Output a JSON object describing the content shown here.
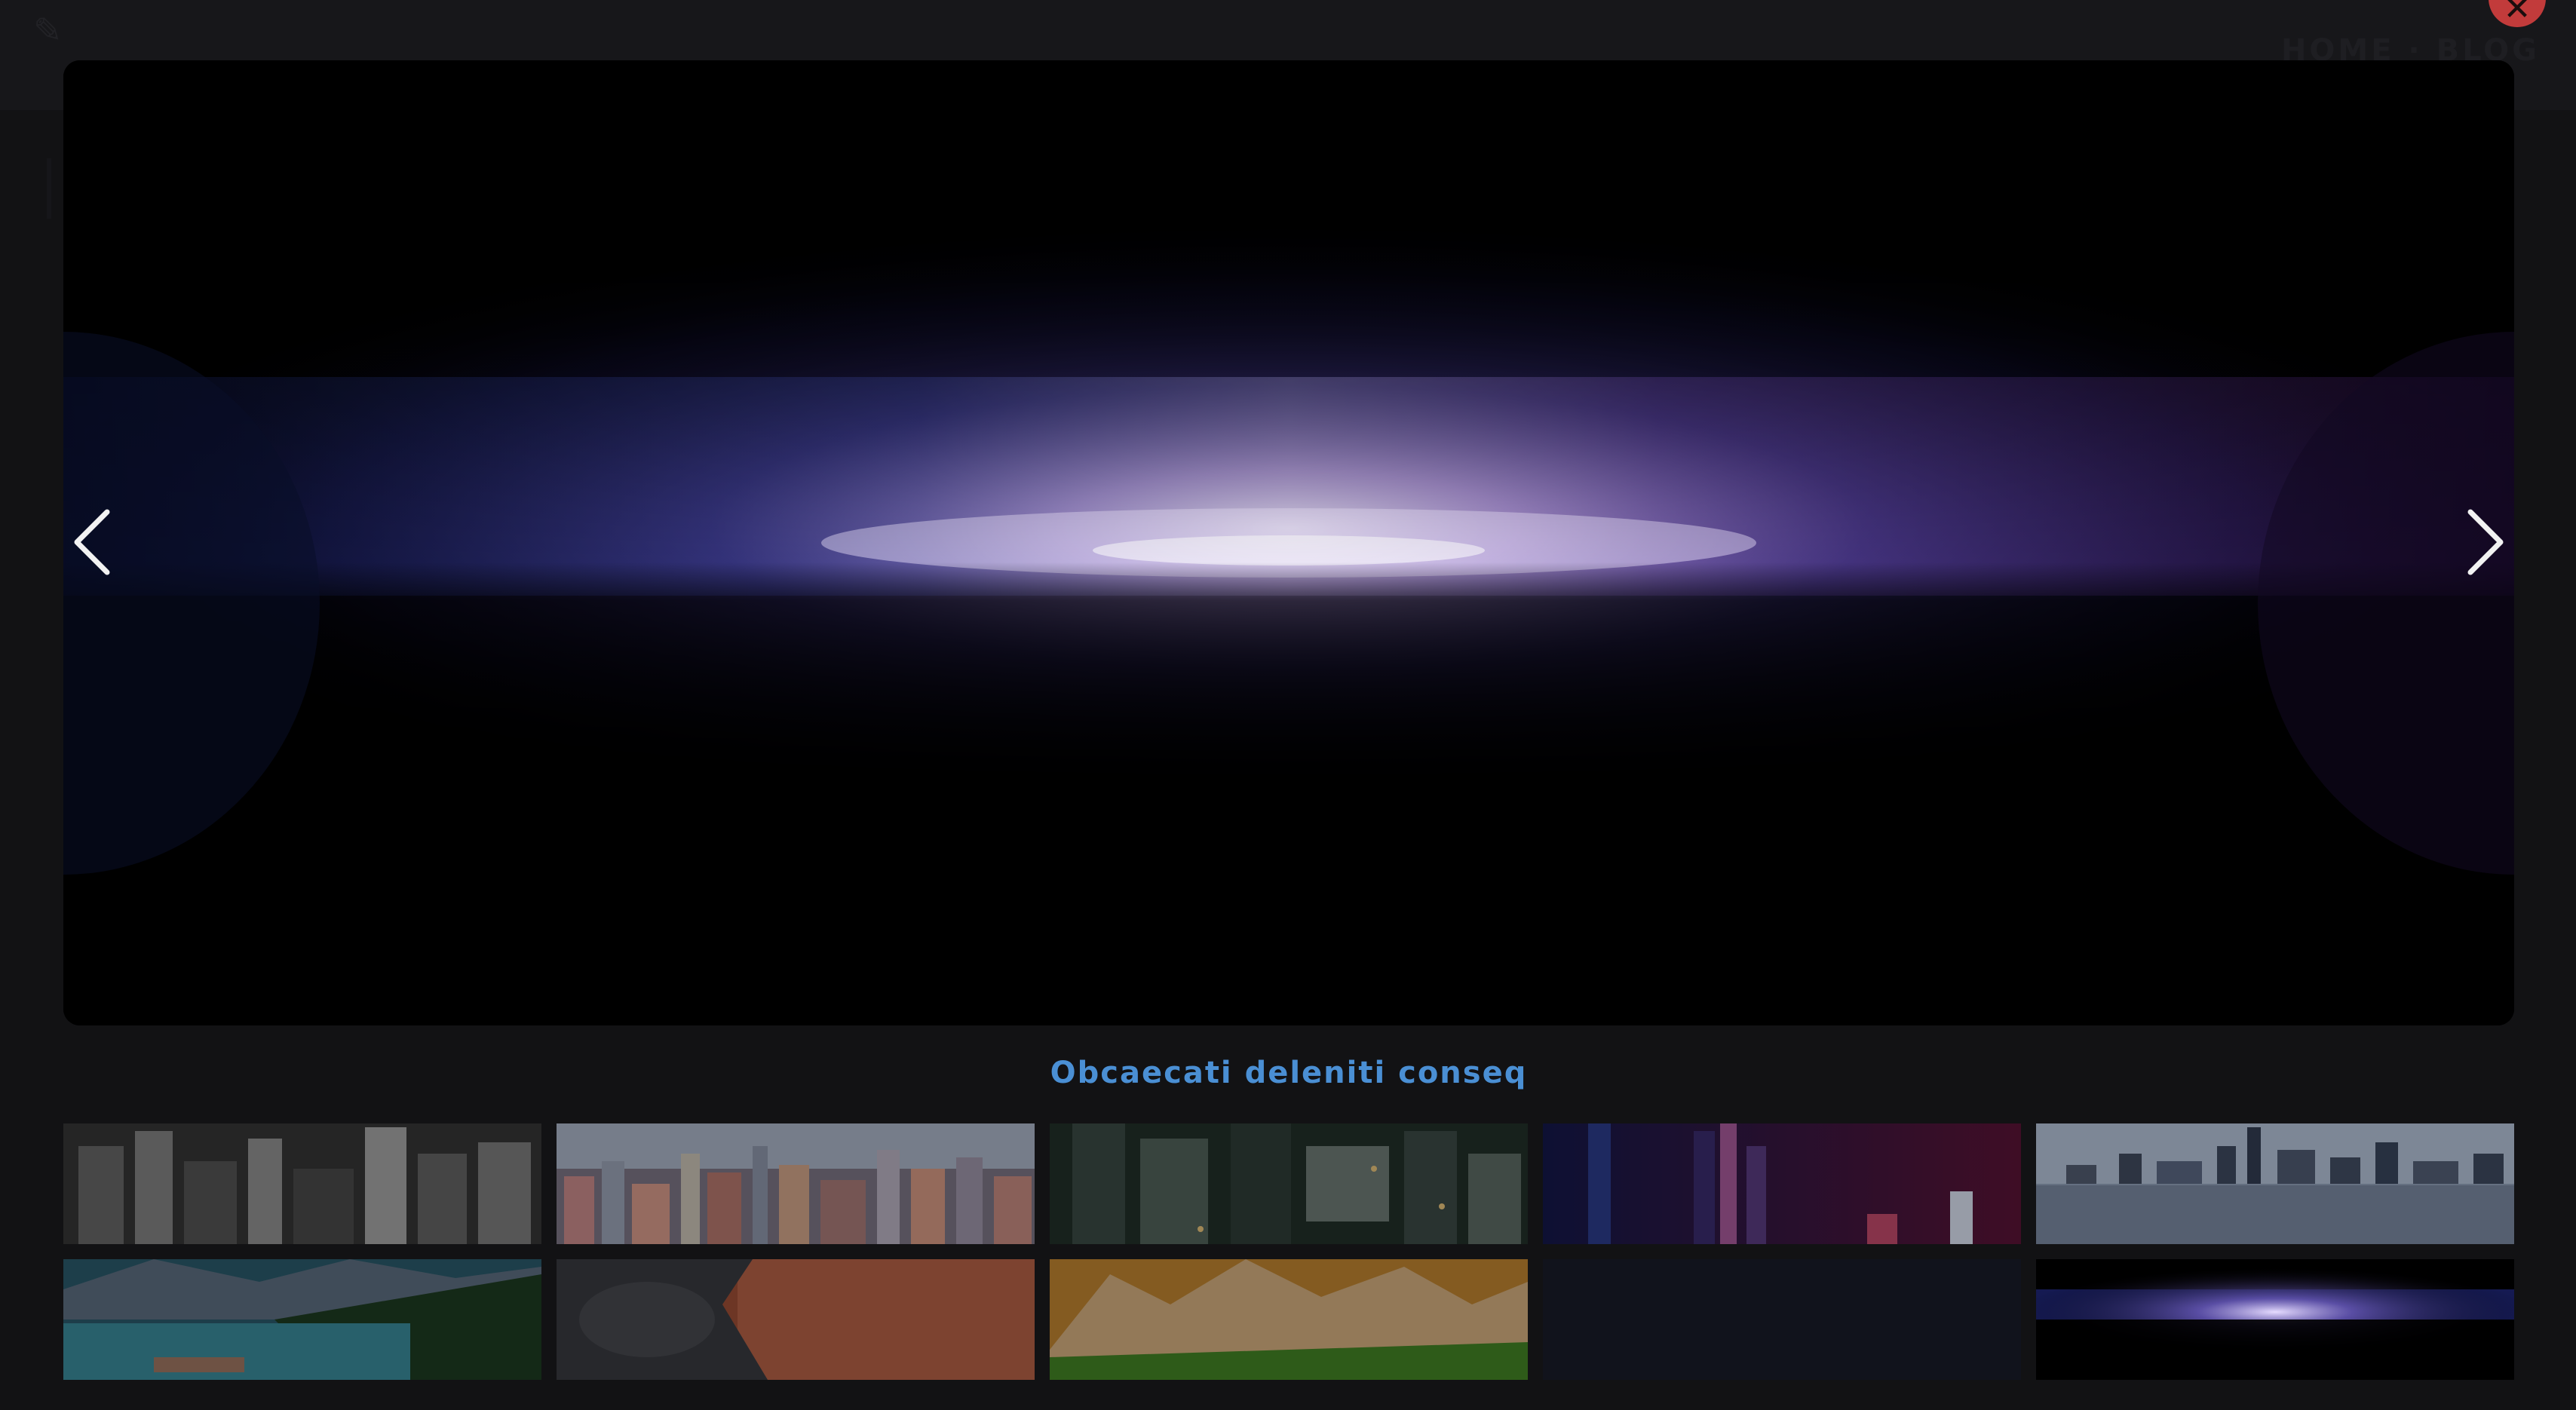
{
  "header": {
    "logo_icon": "brush-icon",
    "nav_label": "HOME · BLOG"
  },
  "lightbox": {
    "close_icon": "close-icon",
    "prev_icon": "chevron-left-icon",
    "next_icon": "chevron-right-icon",
    "caption": "Obcaecati deleniti conseq",
    "accent_color": "#4a8fd4",
    "close_color": "#c23b3b",
    "thumbnails": [
      {
        "name": "thumb-bw-city-aerial"
      },
      {
        "name": "thumb-hong-kong-skyline"
      },
      {
        "name": "thumb-city-rooftops-night"
      },
      {
        "name": "thumb-skyscrapers-night-purple"
      },
      {
        "name": "thumb-manhattan-skyline-reflection"
      },
      {
        "name": "thumb-mountain-lake"
      },
      {
        "name": "thumb-rocks-sunset-water"
      },
      {
        "name": "thumb-dolomites-mountains"
      },
      {
        "name": "thumb-dark-blank"
      },
      {
        "name": "thumb-horizon-glow"
      }
    ]
  }
}
